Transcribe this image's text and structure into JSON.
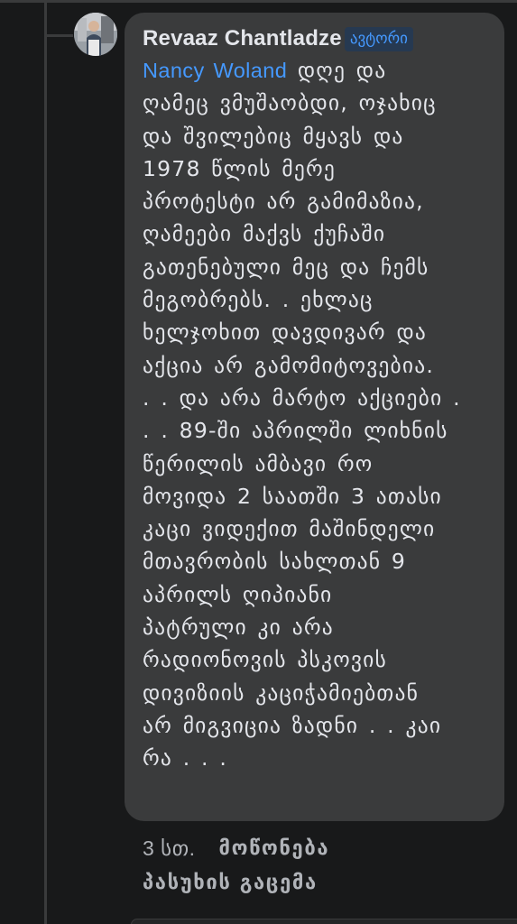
{
  "comment": {
    "author": "Revaaz Chantladze",
    "author_badge": "ავტორი",
    "mention": "Nancy Woland",
    "text_lines": [
      " დღე და",
      "ღამეც ვმუშაობდი, ოჯახიც",
      "და შვილებიც მყავს და",
      "1978 წლის მერე",
      "პროტესტი არ გამიმაზია,",
      "ღამეები მაქვს ქუჩაში",
      "გათენებული მეც და ჩემს",
      "მეგობრებს. . ეხლაც",
      "ხელჯოხით დავდივარ და",
      "აქცია არ გამომიტოვებია.",
      ". . და არა მარტო აქციები .",
      ". . 89-ში აპრილში ლიხნის",
      "წერილის ამბავი რო",
      "მოვიდა 2 საათში 3 ათასი",
      "კაცი ვიდექით მაშინდელი",
      "მთავრობის სახლთან  9",
      "აპრილს ღიპიანი",
      "პატრული კი არა",
      "რადიონოვის პსკოვის",
      "დივიზიის კაციჭამიებთან",
      "არ მიგვიცია ზადნი . . კაი",
      "რა . . ."
    ],
    "avatar_icon": "profile-photo",
    "colors": {
      "background": "#18191a",
      "bubble": "#3a3b3c",
      "text": "#e4e6eb",
      "link": "#4599ff",
      "secondary": "#b0b3b8"
    }
  },
  "actions": {
    "timestamp": "3 სთ.",
    "like_label": "მოწონება",
    "reply_label": "პასუხის გაცემა"
  }
}
